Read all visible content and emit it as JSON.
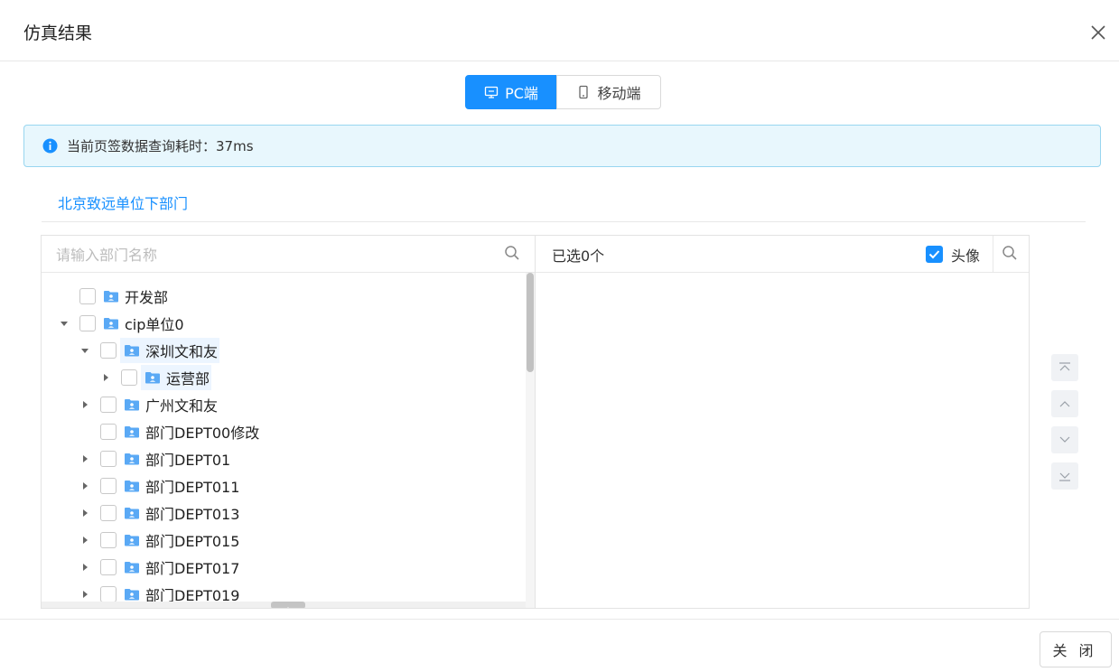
{
  "dialog": {
    "title": "仿真结果",
    "close_label": "关 闭"
  },
  "view_switch": {
    "pc_label": "PC端",
    "mobile_label": "移动端",
    "active": "pc"
  },
  "alert": {
    "text": "当前页签数据查询耗时：37ms"
  },
  "tabs": [
    {
      "label": "北京致远单位下部门",
      "active": true
    }
  ],
  "left_panel": {
    "search_placeholder": "请输入部门名称",
    "tree": [
      {
        "label": "开发部",
        "level": 0,
        "expander": "none",
        "checked": false
      },
      {
        "label": "cip单位0",
        "level": 0,
        "expander": "expanded",
        "checked": false
      },
      {
        "label": "深圳文和友",
        "level": 1,
        "expander": "expanded",
        "checked": false,
        "highlighted": true
      },
      {
        "label": "运营部",
        "level": 2,
        "expander": "collapsed",
        "checked": false,
        "highlighted": true
      },
      {
        "label": "广州文和友",
        "level": 1,
        "expander": "collapsed",
        "checked": false
      },
      {
        "label": "部门DEPT00修改",
        "level": 1,
        "expander": "none",
        "checked": false
      },
      {
        "label": "部门DEPT01",
        "level": 1,
        "expander": "collapsed",
        "checked": false
      },
      {
        "label": "部门DEPT011",
        "level": 1,
        "expander": "collapsed",
        "checked": false
      },
      {
        "label": "部门DEPT013",
        "level": 1,
        "expander": "collapsed",
        "checked": false
      },
      {
        "label": "部门DEPT015",
        "level": 1,
        "expander": "collapsed",
        "checked": false
      },
      {
        "label": "部门DEPT017",
        "level": 1,
        "expander": "collapsed",
        "checked": false
      },
      {
        "label": "部门DEPT019",
        "level": 1,
        "expander": "collapsed",
        "checked": false
      }
    ]
  },
  "right_panel": {
    "selected_text": "已选0个",
    "avatar_label": "头像",
    "avatar_checked": true
  },
  "colors": {
    "primary": "#1890ff",
    "alert_bg": "#e8f7fd",
    "alert_border": "#98d6f0",
    "folder": "#5aa9f5"
  },
  "icons": {
    "close": "close-icon",
    "pc": "monitor-icon",
    "mobile": "phone-icon",
    "info": "info-icon",
    "search": "search-icon",
    "folder": "folder-user-icon",
    "sort": [
      "move-top-icon",
      "move-up-icon",
      "move-down-icon",
      "move-bottom-icon"
    ]
  }
}
